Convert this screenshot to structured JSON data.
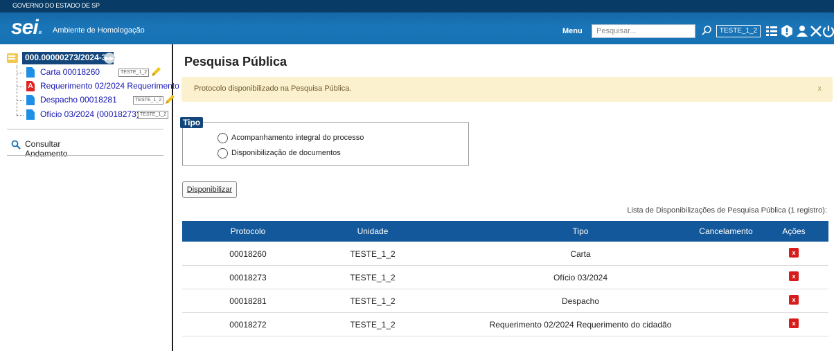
{
  "header": {
    "gov_label": "GOVERNO DO ESTADO DE SP",
    "logo_text": "sei",
    "logo_dot": ".",
    "environment": "Ambiente de Homologação",
    "menu_label": "Menu",
    "search_placeholder": "Pesquisar...",
    "unit": "TESTE_1_2",
    "icons": [
      "list-icon",
      "alert-icon",
      "user-icon",
      "tools-icon",
      "power-icon"
    ]
  },
  "sidebar": {
    "process_number": "000.00000273/2024-30",
    "documents": [
      {
        "label": "Carta 00018260",
        "tag": "TESTE_1_2",
        "type": "doc",
        "signed": true
      },
      {
        "label": "Requerimento 02/2024 Requerimento",
        "tag": "",
        "type": "pdf",
        "signed": false
      },
      {
        "label": "Despacho 00018281",
        "tag": "TESTE_1_2",
        "type": "doc",
        "signed": true
      },
      {
        "label": "Ofício 03/2024 (00018273)",
        "tag": "TESTE_1_2",
        "type": "doc",
        "signed": false
      }
    ],
    "consult_label": "Consultar Andamento"
  },
  "main": {
    "title": "Pesquisa Pública",
    "alert_message": "Protocolo disponibilizado na Pesquisa Pública.",
    "alert_close": "x",
    "fieldset_legend": "Tipo",
    "radio_options": [
      "Acompanhamento integral do processo",
      "Disponibilização de documentos"
    ],
    "button_label": "Disponibilizar",
    "table_caption": "Lista de Disponibilizações de Pesquisa Pública (1 registro):",
    "columns": [
      "Protocolo",
      "Unidade",
      "Tipo",
      "Cancelamento",
      "Ações"
    ],
    "rows": [
      {
        "protocolo": "00018260",
        "unidade": "TESTE_1_2",
        "tipo": "Carta",
        "cancelamento": ""
      },
      {
        "protocolo": "00018273",
        "unidade": "TESTE_1_2",
        "tipo": "Ofício 03/2024",
        "cancelamento": ""
      },
      {
        "protocolo": "00018281",
        "unidade": "TESTE_1_2",
        "tipo": "Despacho",
        "cancelamento": ""
      },
      {
        "protocolo": "00018272",
        "unidade": "TESTE_1_2",
        "tipo": "Requerimento 02/2024 Requerimento do cidadão",
        "cancelamento": ""
      }
    ],
    "delete_icon_text": "x"
  },
  "colors": {
    "header_blue": "#1672b3",
    "dark_blue": "#13467a",
    "alert_bg": "#fcf1cf",
    "delete_red": "#d81c1c",
    "link_blue": "#1414b4"
  }
}
